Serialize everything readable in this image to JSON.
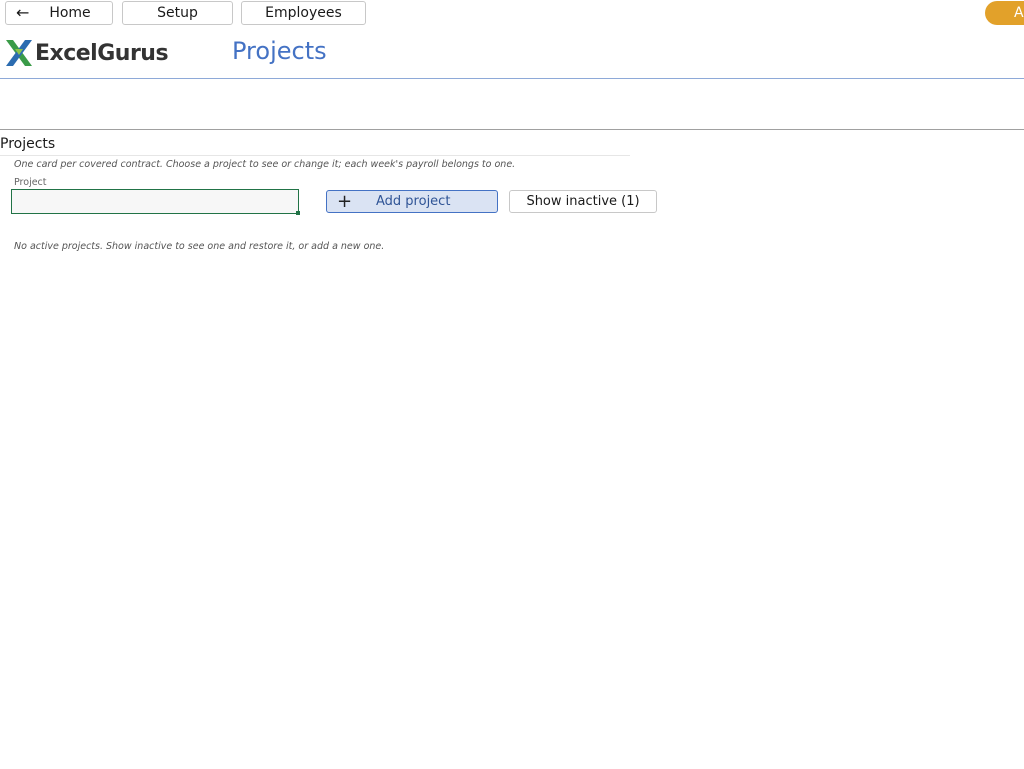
{
  "nav": {
    "home_label": "Home",
    "setup_label": "Setup",
    "employees_label": "Employees",
    "user_initial": "A",
    "back_icon": "arrow-left-icon"
  },
  "header": {
    "logo_text": "ExcelGurus",
    "logo_icon": "excelgurus-x-logo-icon",
    "title": "Projects"
  },
  "section": {
    "title": "Projects",
    "description": "One card per covered contract. Choose a project to see or change it; each week's payroll belongs to one.",
    "field_label": "Project",
    "field_value": "",
    "add_button_label": "Add project",
    "add_icon": "plus-icon",
    "show_inactive_label": "Show inactive (1)",
    "empty_message": "No active projects. Show inactive to see one and restore it, or add a new one."
  },
  "colors": {
    "accent": "#4472c4",
    "user_pill": "#e2a12a",
    "input_border": "#217346",
    "add_button_bg": "#dae3f3"
  }
}
